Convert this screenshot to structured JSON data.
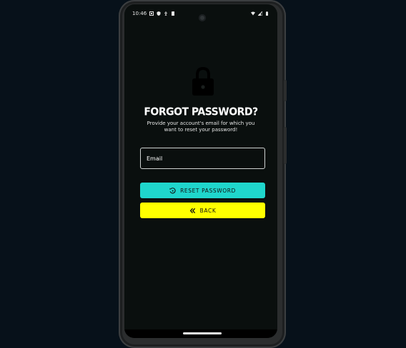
{
  "status_bar": {
    "time": "10:46"
  },
  "forgot": {
    "title": "FORGOT PASSWORD?",
    "subtitle": "Provide your account's email for which you want to reset your password!"
  },
  "form": {
    "email_placeholder": "Email",
    "email_value": ""
  },
  "buttons": {
    "reset_label": "RESET PASSWORD",
    "back_label": "BACK"
  },
  "colors": {
    "reset_bg": "#1fd6cc",
    "back_bg": "#ffff00",
    "screen_bg": "#0a0f0e"
  },
  "icons": {
    "lock": "lock-icon",
    "reset": "reset-icon",
    "back": "double-chevron-left-icon"
  }
}
